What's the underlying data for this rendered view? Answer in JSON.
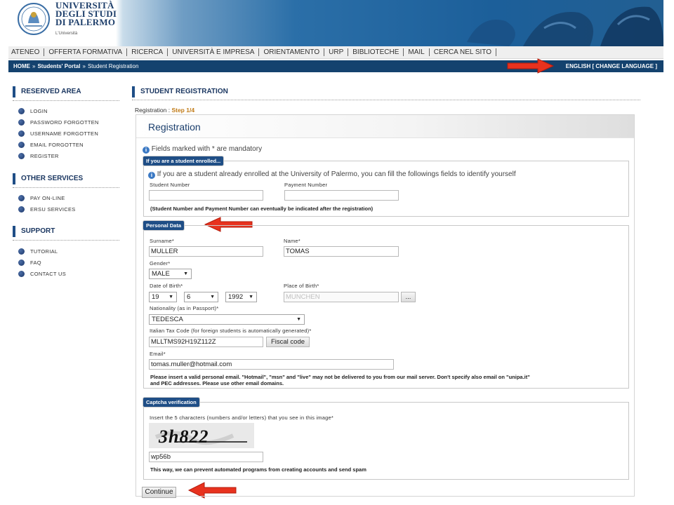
{
  "logo": {
    "name_line1": "UNIVERSITÀ",
    "name_line2": "DEGLI STUDI",
    "name_line3": "DI PALERMO",
    "sub": "L'Università"
  },
  "topnav": [
    "ATENEO",
    "OFFERTA FORMATIVA",
    "RICERCA",
    "UNIVERSITÀ E IMPRESA",
    "ORIENTAMENTO",
    "URP",
    "BIBLIOTECHE",
    "MAIL",
    "CERCA NEL SITO"
  ],
  "breadcrumb": {
    "home": "HOME",
    "sep": "»",
    "portal": "Students' Portal",
    "current": "Student Registration"
  },
  "language": "ENGLISH [ CHANGE LANGUAGE ]",
  "sidebar": {
    "reserved": {
      "title": "RESERVED AREA",
      "items": [
        "LOGIN",
        "PASSWORD FORGOTTEN",
        "USERNAME FORGOTTEN",
        "EMAIL FORGOTTEN",
        "REGISTER"
      ]
    },
    "other": {
      "title": "OTHER SERVICES",
      "items": [
        "PAY ON-LINE",
        "ERSU SERVICES"
      ]
    },
    "support": {
      "title": "SUPPORT",
      "items": [
        "TUTORIAL",
        "FAQ",
        "CONTACT US"
      ]
    }
  },
  "main": {
    "heading": "STUDENT REGISTRATION",
    "step_label": "Registration : ",
    "step_value": "Step 1/4",
    "title": "Registration",
    "mandatory_note": "Fields marked with * are mandatory"
  },
  "enrolled": {
    "legend": "If you are a student enrolled...",
    "info": "If you are a student already enrolled at the University of Palermo, you can fill the followings fields to identify yourself",
    "student_number_label": "Student Number",
    "student_number_value": "",
    "payment_number_label": "Payment Number",
    "payment_number_value": "",
    "note": "(Student Number and Payment Number can eventually be indicated after the registration)"
  },
  "personal": {
    "legend": "Personal Data",
    "surname_label": "Surname*",
    "surname_value": "MULLER",
    "name_label": "Name*",
    "name_value": "TOMAS",
    "gender_label": "Gender*",
    "gender_value": "MALE",
    "dob_label": "Date of Birth*",
    "dob_day": "19",
    "dob_month": "6",
    "dob_year": "1992",
    "pob_label": "Place of Birth*",
    "pob_value": "MUNCHEN",
    "pob_button": "...",
    "nationality_label": "Nationality (as in Passport)*",
    "nationality_value": "TEDESCA",
    "tax_label": "Italian Tax Code (for foreign students is automatically generated)*",
    "tax_value": "MLLTMS92H19Z112Z",
    "fiscal_button": "Fiscal code",
    "email_label": "Email*",
    "email_value": "tomas.muller@hotmail.com",
    "email_note_1": "Please insert a valid personal email. \"Hotmail\", \"msn\" and \"live\" may not be delivered to you from our mail server. Don't specify also email on \"unipa.it\"",
    "email_note_2": "and PEC addresses. Please use other email domains."
  },
  "captcha": {
    "legend": "Captcha verification",
    "label": "Insert the 5 characters (numbers and/or letters) that you see in this image*",
    "image_text": "3h822",
    "value": "wp56b",
    "note": "This way, we can prevent automated programs from creating accounts and send spam"
  },
  "continue_button": "Continue",
  "colors": {
    "accent": "#1f4e86",
    "breadcrumb_bar": "#14426e",
    "arrow": "#e8321e",
    "step": "#c07a15"
  }
}
